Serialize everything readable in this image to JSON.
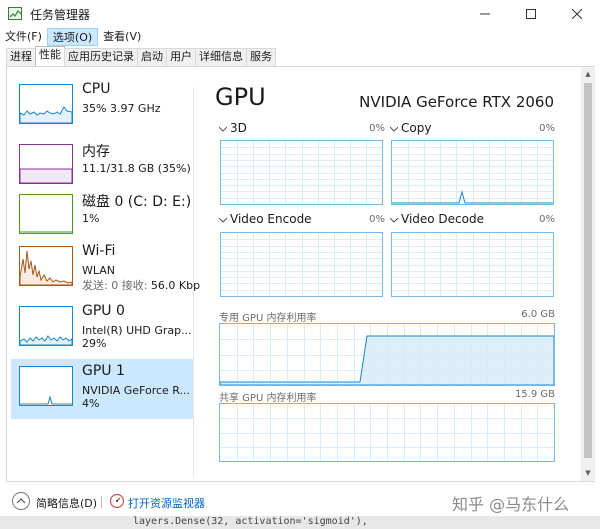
{
  "window": {
    "title": "任务管理器"
  },
  "menu": [
    "文件(F)",
    "选项(O)",
    "查看(V)"
  ],
  "tabs": [
    "进程",
    "性能",
    "应用历史记录",
    "启动",
    "用户",
    "详细信息",
    "服务"
  ],
  "active_tab": "性能",
  "sidebar": {
    "items": [
      {
        "name": "CPU",
        "line1": "35%  3.97 GHz",
        "line2": "",
        "color": "#1a86c8"
      },
      {
        "name": "内存",
        "line1": "11.1/31.8 GB (35%)",
        "line2": "",
        "color": "#8b2f9d"
      },
      {
        "name": "磁盘 0 (C: D: E:)",
        "line1": "1%",
        "line2": "",
        "color": "#4d9a2a"
      },
      {
        "name": "Wi-Fi",
        "line1": "WLAN",
        "line2_label": "发送: 0 接收:",
        "line2": "56.0 Kbp",
        "color": "#a7581a"
      },
      {
        "name": "GPU 0",
        "line1": "Intel(R) UHD Grap...",
        "line2": "29%",
        "color": "#1a86c8"
      },
      {
        "name": "GPU 1",
        "line1": "NVIDIA GeForce R...",
        "line2": "4%",
        "color": "#1a86c8"
      }
    ]
  },
  "detail": {
    "title": "GPU",
    "model": "NVIDIA GeForce RTX 2060",
    "engines": [
      {
        "label": "3D",
        "pct": "0%"
      },
      {
        "label": "Copy",
        "pct": "0%"
      },
      {
        "label": "Video Encode",
        "pct": "0%"
      },
      {
        "label": "Video Decode",
        "pct": "0%"
      }
    ],
    "dedicated_label": "专用 GPU 内存利用率",
    "dedicated_max": "6.0 GB",
    "shared_label": "共享 GPU 内存利用率",
    "shared_max": "15.9 GB"
  },
  "footer": {
    "fewer_details": "简略信息(D)",
    "resource_monitor": "打开资源监视器"
  },
  "overlay": {
    "watermark": "知乎 @马东什么",
    "code": "layers.Dense(32, activation='sigmoid'),"
  },
  "colors": {
    "accent": "#1a86c8",
    "selected_bg": "#cce8ff",
    "graph_border": "#78b8e8"
  }
}
